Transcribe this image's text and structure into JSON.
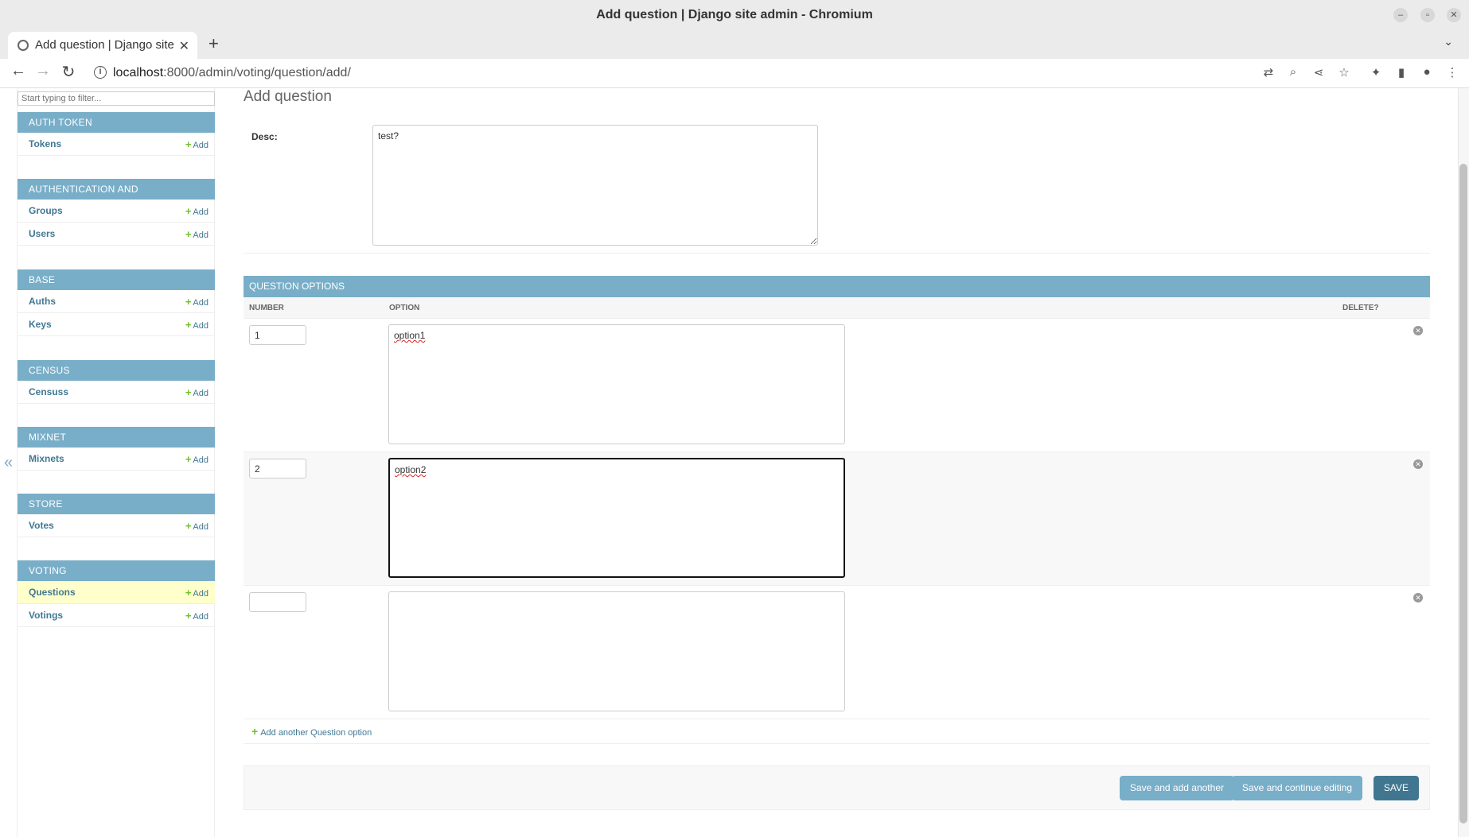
{
  "window": {
    "title": "Add question | Django site admin - Chromium",
    "tab_title": "Add question | Django site admin",
    "url_host": "localhost",
    "url_rest": ":8000/admin/voting/question/add/"
  },
  "sidebar": {
    "filter_placeholder": "Start typing to filter...",
    "collapse_glyph": "«",
    "add_label": "Add",
    "modules": [
      {
        "caption": "AUTH TOKEN",
        "models": [
          "Tokens"
        ]
      },
      {
        "caption": "AUTHENTICATION AND AUTHORIZATION",
        "models": [
          "Groups",
          "Users"
        ]
      },
      {
        "caption": "BASE",
        "models": [
          "Auths",
          "Keys"
        ]
      },
      {
        "caption": "CENSUS",
        "models": [
          "Censuss"
        ]
      },
      {
        "caption": "MIXNET",
        "models": [
          "Mixnets"
        ]
      },
      {
        "caption": "STORE",
        "models": [
          "Votes"
        ]
      },
      {
        "caption": "VOTING",
        "models": [
          "Questions",
          "Votings"
        ]
      }
    ],
    "current_model": "Questions"
  },
  "main": {
    "page_title": "Add question",
    "desc_label": "Desc:",
    "desc_value": "test?",
    "inline": {
      "caption": "QUESTION OPTIONS",
      "headers": {
        "number": "NUMBER",
        "option": "OPTION",
        "delete": "DELETE?"
      },
      "rows": [
        {
          "number": "1",
          "option": "option1"
        },
        {
          "number": "2",
          "option": "option2",
          "focused": true
        },
        {
          "number": "",
          "option": ""
        }
      ],
      "add_another": "Add another Question option"
    },
    "buttons": {
      "save_add_another": "Save and add another",
      "save_continue": "Save and continue editing",
      "save": "SAVE"
    }
  },
  "colors": {
    "module_header": "#79aec8",
    "link": "#417893",
    "add_plus": "#70bf2b",
    "save_button": "#417690",
    "current_row": "#ffffcc"
  }
}
